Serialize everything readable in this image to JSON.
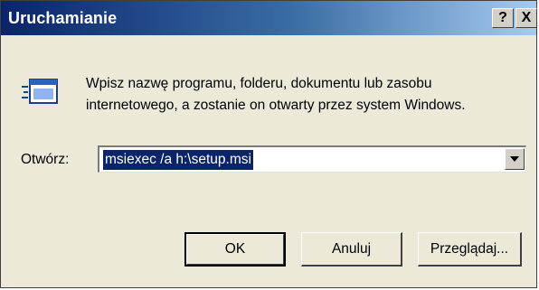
{
  "window": {
    "title": "Uruchamianie",
    "help_button": "?",
    "close_button": "X"
  },
  "description": {
    "line1": "Wpisz nazwę programu, folderu, dokumentu lub zasobu",
    "line2": "internetowego, a zostanie on otwarty przez system Windows."
  },
  "open": {
    "label": "Otwórz:",
    "value": "msiexec /a h:\\setup.msi"
  },
  "buttons": {
    "ok": "OK",
    "cancel": "Anuluj",
    "browse": "Przeglądaj..."
  },
  "icons": {
    "run": "run-program-icon",
    "dropdown": "dropdown-arrow-icon"
  },
  "colors": {
    "title_bar": "#0a246a",
    "selection": "#0a246a",
    "dialog_face": "#ece9d8"
  }
}
